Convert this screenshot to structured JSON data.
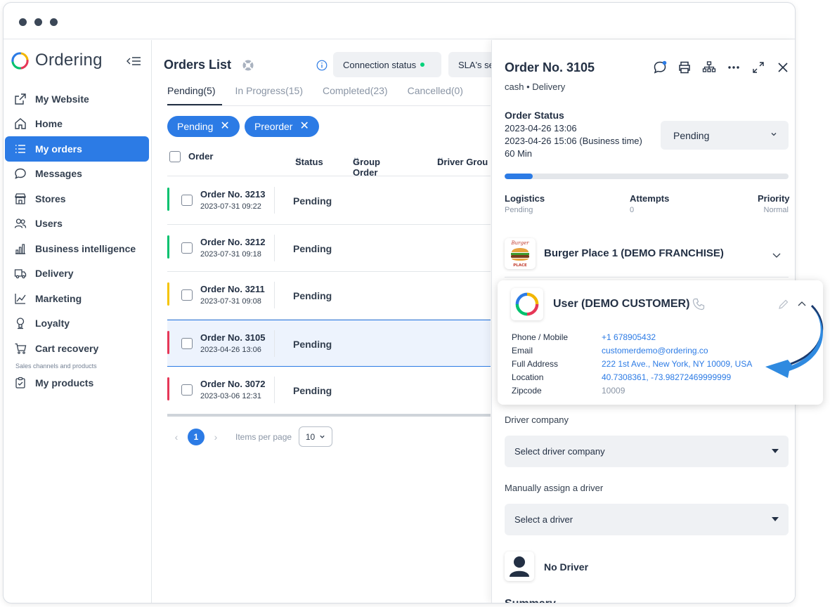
{
  "brand": {
    "name": "Ordering"
  },
  "sidebar": {
    "items": [
      {
        "label": "My Website",
        "icon": "external-link-icon"
      },
      {
        "label": "Home",
        "icon": "home-icon"
      },
      {
        "label": "My orders",
        "icon": "list-icon",
        "active": true
      },
      {
        "label": "Messages",
        "icon": "chat-icon"
      },
      {
        "label": "Stores",
        "icon": "store-icon"
      },
      {
        "label": "Users",
        "icon": "users-icon"
      },
      {
        "label": "Business intelligence",
        "icon": "bar-chart-icon"
      },
      {
        "label": "Delivery",
        "icon": "truck-icon"
      },
      {
        "label": "Marketing",
        "icon": "trend-icon"
      },
      {
        "label": "Loyalty",
        "icon": "medal-icon"
      },
      {
        "label": "Cart recovery",
        "icon": "cart-icon"
      }
    ],
    "section_label": "Sales channels and products",
    "section_items": [
      {
        "label": "My products",
        "icon": "clipboard-icon"
      }
    ]
  },
  "orders": {
    "title": "Orders List",
    "connection_status": "Connection status",
    "sla_label": "SLA's se",
    "tabs": [
      "Pending(5)",
      "In Progress(15)",
      "Completed(23)",
      "Cancelled(0)"
    ],
    "chips": [
      "Pending",
      "Preorder"
    ],
    "columns": [
      "Order",
      "Status",
      "Group Order",
      "Driver Grou"
    ],
    "rows": [
      {
        "name": "Order No. 3213",
        "date": "2023-07-31 09:22",
        "status": "Pending",
        "color": "#00c16e"
      },
      {
        "name": "Order No. 3212",
        "date": "2023-07-31 09:18",
        "status": "Pending",
        "color": "#00c16e"
      },
      {
        "name": "Order No. 3211",
        "date": "2023-07-31 09:08",
        "status": "Pending",
        "color": "#f5c400"
      },
      {
        "name": "Order No. 3105",
        "date": "2023-04-26 13:06",
        "status": "Pending",
        "color": "#e63757",
        "selected": true
      },
      {
        "name": "Order No. 3072",
        "date": "2023-03-06 12:31",
        "status": "Pending",
        "color": "#e63757"
      }
    ],
    "pager": {
      "page": "1",
      "items_per_page_label": "Items per page",
      "items_per_page": "10"
    }
  },
  "detail": {
    "title": "Order No. 3105",
    "subtitle": "cash • Delivery",
    "status_label": "Order Status",
    "status_lines": [
      "2023-04-26 13:06",
      "2023-04-26 15:06 (Business time)",
      "60 Min"
    ],
    "status_value": "Pending",
    "progress": 0.1,
    "meta": [
      {
        "label": "Logistics",
        "value": "Pending"
      },
      {
        "label": "Attempts",
        "value": "0"
      },
      {
        "label": "Priority",
        "value": "Normal"
      }
    ],
    "store_name": "Burger Place 1 (DEMO FRANCHISE)",
    "store_logo_text": [
      "Burger",
      "PLACE"
    ],
    "customer": {
      "name": "User (DEMO CUSTOMER)",
      "fields": [
        {
          "k": "Phone / Mobile",
          "v": "+1 678905432"
        },
        {
          "k": "Email",
          "v": "customerdemo@ordering.co"
        },
        {
          "k": "Full Address",
          "v": "222 1st Ave., New York, NY 10009, USA"
        },
        {
          "k": "Location",
          "v": "40.7308361, -73.98272469999999"
        },
        {
          "k": "Zipcode",
          "v": "10009"
        }
      ]
    },
    "driver_company_label": "Driver company",
    "driver_company_placeholder": "Select driver company",
    "assign_driver_label": "Manually assign a driver",
    "assign_driver_placeholder": "Select a driver",
    "driver_name": "No Driver",
    "summary_label": "Summary"
  },
  "colors": {
    "accent": "#2c7be5",
    "online": "#00d27a"
  }
}
